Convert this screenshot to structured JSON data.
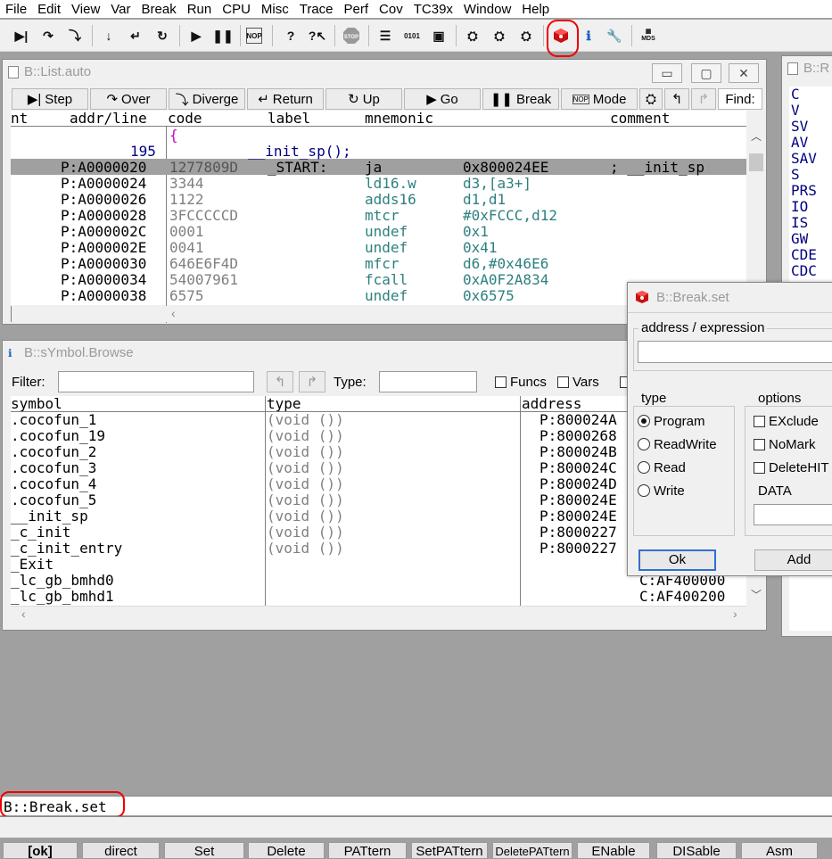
{
  "menu": [
    "File",
    "Edit",
    "View",
    "Var",
    "Break",
    "Run",
    "CPU",
    "Misc",
    "Trace",
    "Perf",
    "Cov",
    "TC39x",
    "Window",
    "Help"
  ],
  "toolbar": {
    "icons": [
      "step-icon",
      "step-over-icon",
      "step-diverge-icon",
      "step-down-icon",
      "return-icon",
      "up-icon",
      "go-icon",
      "break-icon",
      "nop-icon",
      "help-icon",
      "help-pointer-icon",
      "stop-icon",
      "list-icon",
      "memory-icon",
      "chip-icon",
      "register-icon",
      "peripheral-icon",
      "trace-icon",
      "breakpoint-set-icon",
      "info-icon",
      "wrench-icon",
      "mds-icon"
    ],
    "mds_text": "MDS"
  },
  "list_window": {
    "title": "B::List.auto",
    "buttons": [
      "Step",
      "Over",
      "Diverge",
      "Return",
      "Up",
      "Go",
      "Break",
      "Mode"
    ],
    "find_label": "Find:",
    "columns": [
      "nt",
      "addr/line",
      "code",
      "label",
      "mnemonic",
      "comment"
    ],
    "rows": [
      {
        "addr": "",
        "code": "{",
        "label": "",
        "mnemonic": "",
        "operand": "",
        "comment": ""
      },
      {
        "addr": "195",
        "code": "",
        "label": "__init_sp();",
        "mnemonic": "",
        "operand": "",
        "comment": ""
      },
      {
        "addr": "P:A0000020",
        "code": "1277809D",
        "label": "_START:",
        "mnemonic": "ja",
        "operand": "0x800024EE",
        "comment": "; __init_sp"
      },
      {
        "addr": "P:A0000024",
        "code": "3344",
        "label": "",
        "mnemonic": "ld16.w",
        "operand": "d3,[a3+]",
        "comment": ""
      },
      {
        "addr": "P:A0000026",
        "code": "1122",
        "label": "",
        "mnemonic": "adds16",
        "operand": "d1,d1",
        "comment": ""
      },
      {
        "addr": "P:A0000028",
        "code": "3FCCCCCD",
        "label": "",
        "mnemonic": "mtcr",
        "operand": "#0xFCCC,d12",
        "comment": ""
      },
      {
        "addr": "P:A000002C",
        "code": "0001",
        "label": "",
        "mnemonic": "undef",
        "operand": "0x1",
        "comment": ""
      },
      {
        "addr": "P:A000002E",
        "code": "0041",
        "label": "",
        "mnemonic": "undef",
        "operand": "0x41",
        "comment": ""
      },
      {
        "addr": "P:A0000030",
        "code": "646E6F4D",
        "label": "",
        "mnemonic": "mfcr",
        "operand": "d6,#0x46E6",
        "comment": ""
      },
      {
        "addr": "P:A0000034",
        "code": "54007961",
        "label": "",
        "mnemonic": "fcall",
        "operand": "0xA0F2A834",
        "comment": ""
      },
      {
        "addr": "P:A0000038",
        "code": "6575",
        "label": "",
        "mnemonic": "undef",
        "operand": "0x6575",
        "comment": ""
      }
    ]
  },
  "register_window": {
    "title": "B::R",
    "labels": [
      "C",
      "V",
      "SV",
      "AV",
      "SAV",
      "S",
      "PRS",
      "IO",
      "IS",
      "GW",
      "CDE",
      "CDC"
    ]
  },
  "symbol_window": {
    "title": "B::sYmbol.Browse",
    "filter_label": "Filter:",
    "filter_value": "",
    "type_label": "Type:",
    "type_value": "",
    "funcs_label": "Funcs",
    "vars_label": "Vars",
    "columns": [
      "symbol",
      "type",
      "address"
    ],
    "rows": [
      {
        "symbol": ".cocofun_1",
        "type": "(void ())",
        "address": "P:800024A"
      },
      {
        "symbol": ".cocofun_19",
        "type": "(void ())",
        "address": "P:8000268"
      },
      {
        "symbol": ".cocofun_2",
        "type": "(void ())",
        "address": "P:800024B"
      },
      {
        "symbol": ".cocofun_3",
        "type": "(void ())",
        "address": "P:800024C"
      },
      {
        "symbol": ".cocofun_4",
        "type": "(void ())",
        "address": "P:800024D"
      },
      {
        "symbol": ".cocofun_5",
        "type": "(void ())",
        "address": "P:800024E"
      },
      {
        "symbol": "__init_sp",
        "type": "(void ())",
        "address": "P:800024E"
      },
      {
        "symbol": "_c_init",
        "type": "(void ())",
        "address": "P:8000227"
      },
      {
        "symbol": "_c_init_entry",
        "type": "(void ())",
        "address": "P:8000227"
      },
      {
        "symbol": "_Exit",
        "type": "",
        "address": ""
      },
      {
        "symbol": "_lc_gb_bmhd0",
        "type": "",
        "address": "C:AF400000"
      },
      {
        "symbol": "_lc_gb_bmhd1",
        "type": "",
        "address": "C:AF400200"
      }
    ]
  },
  "break_dialog": {
    "title": "B::Break.set",
    "address_label": "address / expression",
    "address_value": "",
    "type_label": "type",
    "types": [
      "Program",
      "ReadWrite",
      "Read",
      "Write"
    ],
    "selected_type": "Program",
    "options_label": "options",
    "options": [
      "EXclude",
      "NoMark",
      "DeleteHIT"
    ],
    "data_label": "DATA",
    "data_value": "",
    "ok_label": "Ok",
    "add_label": "Add"
  },
  "command_line": {
    "value": "B::Break.set"
  },
  "softkeys": [
    "[ok]",
    "direct",
    "Set",
    "Delete",
    "PATtern",
    "SetPATtern",
    "DeletePATtern",
    "ENable",
    "DISable",
    "Asm"
  ],
  "colors": {
    "highlight_row": "#a0a0a0",
    "teal": "#2d8080",
    "navy": "#000080",
    "red_circle": "#e00000"
  }
}
